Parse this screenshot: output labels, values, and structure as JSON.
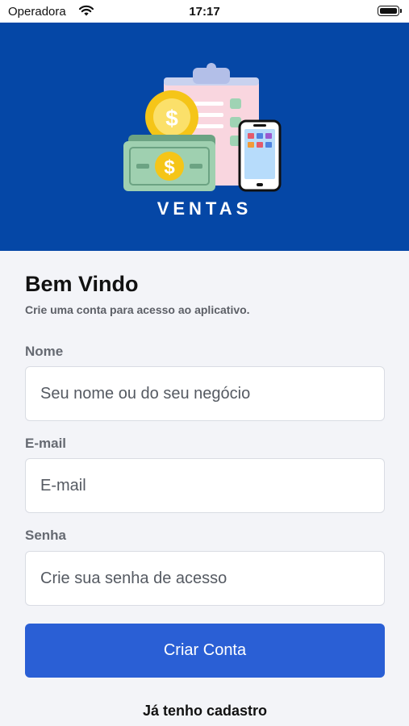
{
  "status_bar": {
    "carrier": "Operadora",
    "time": "17:17"
  },
  "hero": {
    "brand": "VENTAS",
    "background": "#0547a6"
  },
  "form": {
    "title": "Bem Vindo",
    "subtitle": "Crie uma conta para acesso ao aplicativo.",
    "fields": [
      {
        "label": "Nome",
        "placeholder": "Seu nome ou do seu negócio",
        "value": ""
      },
      {
        "label": "E-mail",
        "placeholder": "E-mail",
        "value": ""
      },
      {
        "label": "Senha",
        "placeholder": "Crie sua senha de acesso",
        "value": ""
      }
    ],
    "submit_label": "Criar Conta",
    "login_link": "Já tenho cadastro"
  },
  "colors": {
    "primary_button": "#2a5fd5",
    "page_background": "#f3f4f8"
  },
  "icons": [
    "wifi-icon",
    "battery-icon",
    "sales-logo"
  ]
}
